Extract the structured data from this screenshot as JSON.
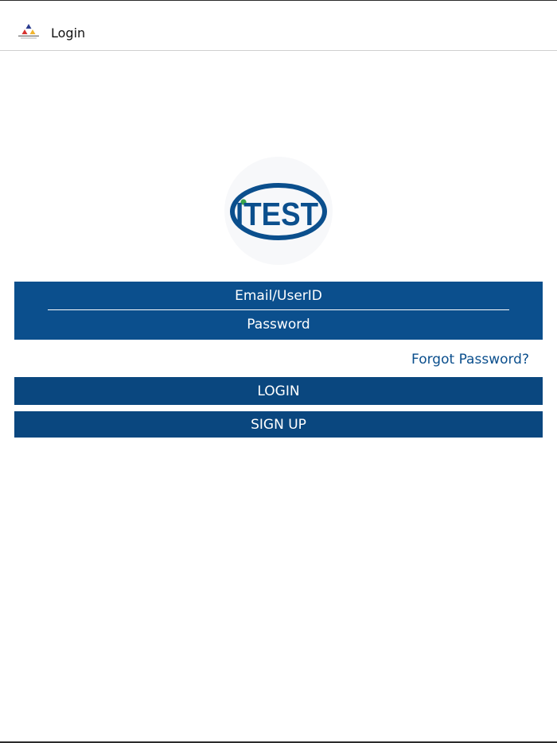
{
  "header": {
    "title": "Login",
    "logo_icon": "college-logo-icon"
  },
  "brand": {
    "logo_text": "ITEST",
    "ring_color": "#0b4f8d",
    "dot_color": "#3aa54a"
  },
  "form": {
    "email_placeholder": "Email/UserID",
    "email_value": "",
    "password_placeholder": "Password",
    "password_value": "",
    "forgot_label": "Forgot Password?",
    "login_label": "LOGIN",
    "signup_label": "SIGN UP"
  },
  "colors": {
    "panel": "#0b4f8d",
    "button": "#0a477f",
    "link": "#0b4f8d"
  }
}
